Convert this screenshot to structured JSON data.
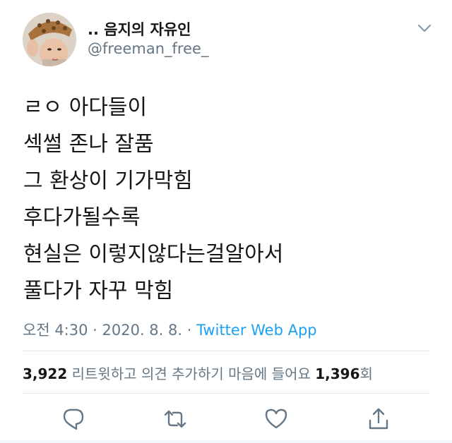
{
  "user": {
    "display_name": ".. 음지의 자유인",
    "handle": "@freeman_free_"
  },
  "tweet": {
    "lines": [
      "ㄹㅇ 아다들이",
      "섹썰 존나 잘품",
      "그 환상이 기가막힘",
      "후다가될수록",
      "현실은 이렇지않다는걸알아서",
      "풀다가 자꾸 막힘"
    ]
  },
  "meta": {
    "time_date": "오전 4:30 · 2020. 8. 8. · ",
    "source": "Twitter Web App"
  },
  "stats": {
    "retweets": "3,922",
    "retweets_label": " 리트윗하고 의견 추가하기  ",
    "likes_label": "마음에 들어요 ",
    "likes": "1,396",
    "likes_suffix": "회"
  },
  "colors": {
    "link": "#1da1f2",
    "secondary_text": "#657786",
    "icon": "#657786"
  },
  "icons": [
    "chevron-down-icon",
    "reply-icon",
    "retweet-icon",
    "like-icon",
    "share-icon"
  ]
}
